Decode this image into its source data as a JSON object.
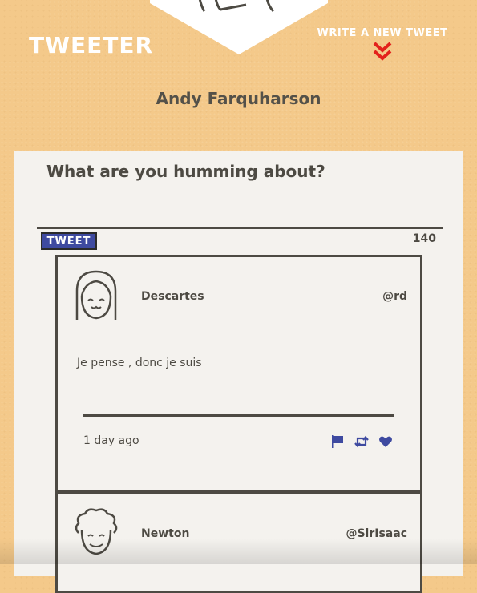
{
  "nav": {
    "brand": "TWEETER",
    "compose_label": "WRITE A NEW TWEET"
  },
  "user": {
    "name": "Andy Farquharson"
  },
  "compose": {
    "prompt": "What are you humming about?",
    "placeholder": "",
    "button_label": "TWEET",
    "counter": "140"
  },
  "tweets": [
    {
      "name": "Descartes",
      "handle": "@rd",
      "text": "Je pense , donc je suis",
      "time": "1 day ago",
      "avatar_icon": "smiling-girl-avatar"
    },
    {
      "name": "Newton",
      "handle": "@SirIsaac",
      "avatar_icon": "curly-hair-man-avatar"
    }
  ],
  "icons": [
    "flag-icon",
    "retweet-icon",
    "heart-icon",
    "chevron-double-down-icon"
  ],
  "colors": {
    "background": "#f4c98a",
    "panel": "#f4f2ee",
    "accent": "#3e4aa0",
    "chevron": "#e3221c",
    "text": "#4d4a43"
  }
}
